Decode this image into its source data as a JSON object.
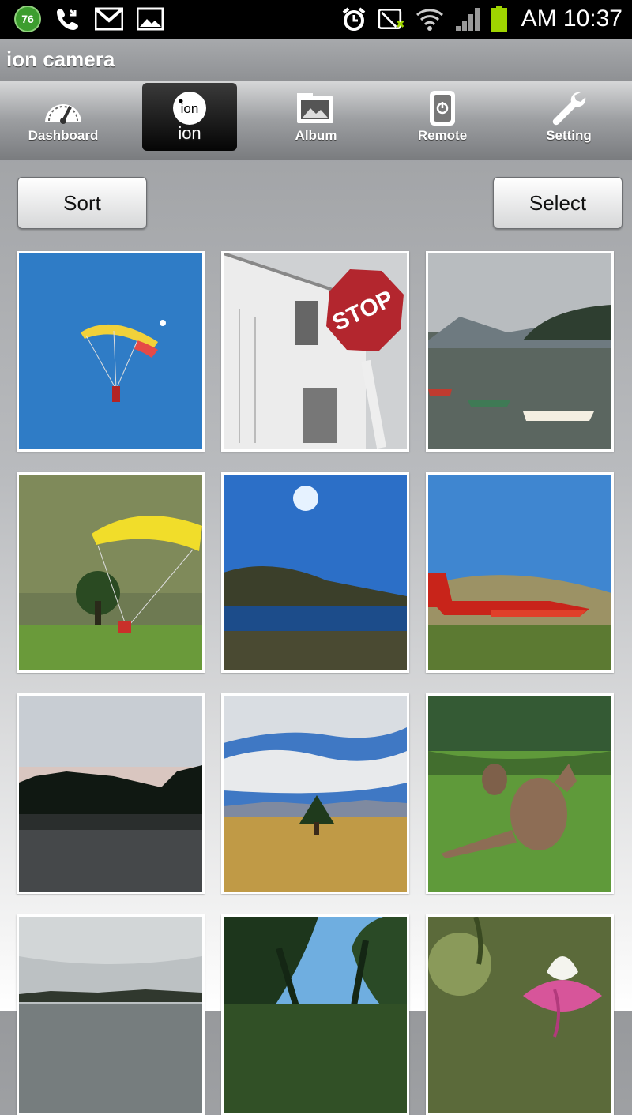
{
  "status_bar": {
    "notification_count": "76",
    "time": "AM 10:37"
  },
  "app": {
    "title": "ion camera"
  },
  "tabs": [
    {
      "label": "Dashboard",
      "icon": "dashboard-gauge-icon",
      "active": false
    },
    {
      "label": "ion",
      "icon": "ion-logo-icon",
      "active": true
    },
    {
      "label": "Album",
      "icon": "album-photo-icon",
      "active": false
    },
    {
      "label": "Remote",
      "icon": "remote-power-icon",
      "active": false
    },
    {
      "label": "Setting",
      "icon": "wrench-icon",
      "active": false
    }
  ],
  "toolbar": {
    "sort_label": "Sort",
    "select_label": "Select"
  },
  "colors": {
    "accent_active_tab": "#111111",
    "battery": "#9fd400"
  },
  "gallery": [
    {
      "subject": "paraglider-sky"
    },
    {
      "subject": "stop-sign-house"
    },
    {
      "subject": "lake-boats"
    },
    {
      "subject": "yellow-paraglider-landing"
    },
    {
      "subject": "lake-sun"
    },
    {
      "subject": "red-plane"
    },
    {
      "subject": "dusk-lake"
    },
    {
      "subject": "tree-field"
    },
    {
      "subject": "wallabies"
    },
    {
      "subject": "grey-lake"
    },
    {
      "subject": "pine-trees"
    },
    {
      "subject": "flower"
    }
  ]
}
